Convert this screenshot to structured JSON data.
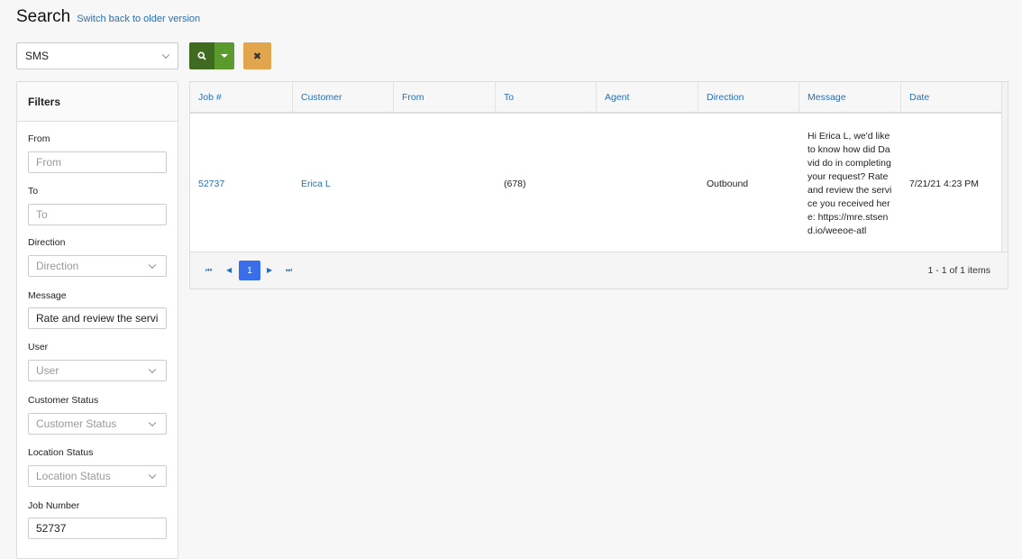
{
  "header": {
    "title": "Search",
    "switch_link": "Switch back to older version"
  },
  "search_type": {
    "selected": "SMS"
  },
  "colors": {
    "search_button": "#3e6b1f",
    "search_dropdown": "#5b9a2c",
    "clear_button": "#e0a54d",
    "link": "#2a6fb0",
    "page_active": "#3a6ee8"
  },
  "icons": {
    "search": "search-icon",
    "dropdown": "caret-down-icon",
    "clear": "close-icon"
  },
  "filters": {
    "title": "Filters",
    "from": {
      "label": "From",
      "placeholder": "From",
      "value": ""
    },
    "to": {
      "label": "To",
      "placeholder": "To",
      "value": ""
    },
    "direction": {
      "label": "Direction",
      "placeholder": "Direction"
    },
    "message": {
      "label": "Message",
      "value": "Rate and review the servi"
    },
    "user": {
      "label": "User",
      "placeholder": "User"
    },
    "customer_status": {
      "label": "Customer Status",
      "placeholder": "Customer Status"
    },
    "location_status": {
      "label": "Location Status",
      "placeholder": "Location Status"
    },
    "job_number": {
      "label": "Job Number",
      "value": "52737"
    }
  },
  "table": {
    "columns": [
      "Job #",
      "Customer",
      "From",
      "To",
      "Agent",
      "Direction",
      "Message",
      "Date"
    ],
    "rows": [
      {
        "job": "52737",
        "customer": "Erica L",
        "from": "",
        "to": "(678)",
        "agent": "",
        "direction": "Outbound",
        "message": "Hi Erica L, we'd like to know how did David do in completing your request? Rate and review the service you received here: https://mre.stsend.io/weeoe-atl",
        "date": "7/21/21 4:23 PM"
      }
    ]
  },
  "pager": {
    "first": "⏮",
    "prev": "◀",
    "current_page": "1",
    "next": "▶",
    "last": "⏭",
    "info": "1 - 1 of 1 items"
  }
}
